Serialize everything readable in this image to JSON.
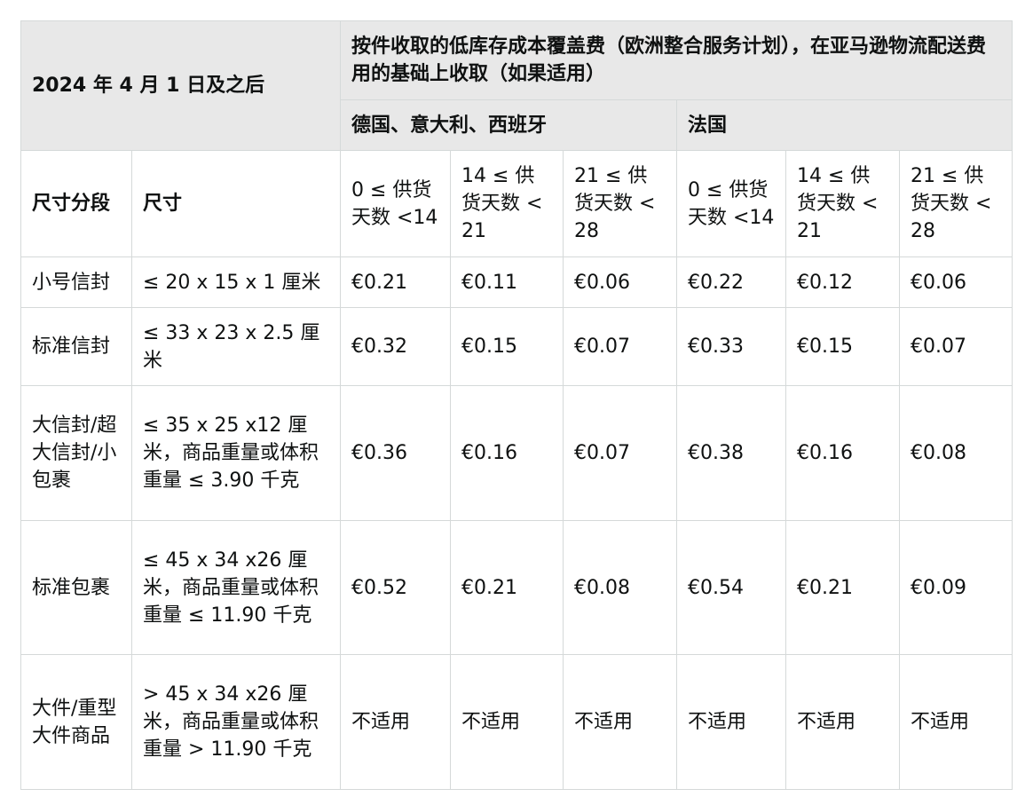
{
  "header": {
    "date_label": "2024 年 4 月 1 日及之后",
    "fee_title": "按件收取的低库存成本覆盖费（欧洲整合服务计划），在亚马逊物流配送费用的基础上收取（如果适用）",
    "region_1": "德国、意大利、西班牙",
    "region_2": "法国",
    "col_tier": "尺寸分段",
    "col_size": "尺寸",
    "supply_ranges": [
      "0 ≤ 供货天数 <14",
      "14 ≤ 供货天数 <21",
      "21 ≤ 供货天数 <28",
      "0 ≤ 供货天数 <14",
      "14 ≤ 供货天数 <21",
      "21 ≤ 供货天数 <28"
    ]
  },
  "rows": [
    {
      "tier": "小号信封",
      "size": "≤ 20 x 15 x 1 厘米",
      "fees": [
        "€0.21",
        "€0.11",
        "€0.06",
        "€0.22",
        "€0.12",
        "€0.06"
      ]
    },
    {
      "tier": "标准信封",
      "size": "≤ 33 x 23 x 2.5 厘米",
      "fees": [
        "€0.32",
        "€0.15",
        "€0.07",
        "€0.33",
        "€0.15",
        "€0.07"
      ]
    },
    {
      "tier": "大信封/超大信封/小包裹",
      "size": "≤ 35 x 25 x12 厘米，商品重量或体积重量 ≤ 3.90 千克",
      "fees": [
        "€0.36",
        "€0.16",
        "€0.07",
        "€0.38",
        "€0.16",
        "€0.08"
      ]
    },
    {
      "tier": "标准包裹",
      "size": "≤ 45 x 34 x26 厘米，商品重量或体积重量 ≤ 11.90 千克",
      "fees": [
        "€0.52",
        "€0.21",
        "€0.08",
        "€0.54",
        "€0.21",
        "€0.09"
      ]
    },
    {
      "tier": "大件/重型大件商品",
      "size": "> 45 x 34 x26 厘米，商品重量或体积重量 > 11.90 千克",
      "fees": [
        "不适用",
        "不适用",
        "不适用",
        "不适用",
        "不适用",
        "不适用"
      ]
    }
  ]
}
